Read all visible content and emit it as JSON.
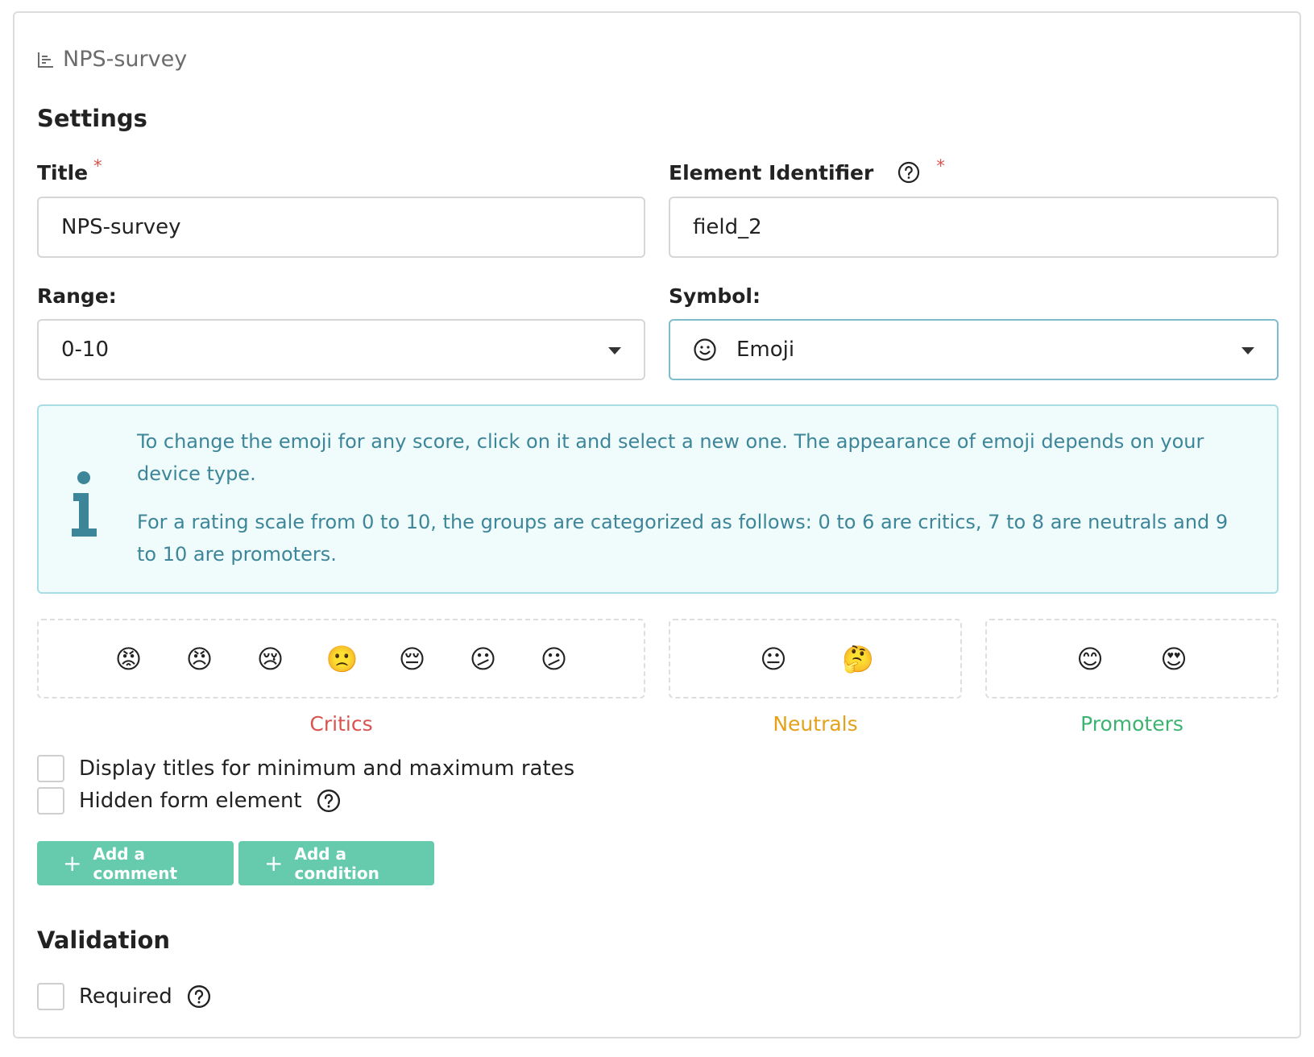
{
  "breadcrumb": {
    "icon": "bar-chart-icon",
    "label": "NPS-survey"
  },
  "settings": {
    "heading": "Settings",
    "title": {
      "label": "Title",
      "required_mark": "*",
      "value": "NPS-survey"
    },
    "identifier": {
      "label": "Element Identifier",
      "required_mark": "*",
      "value": "field_2"
    },
    "range": {
      "label": "Range:",
      "value": "0-10"
    },
    "symbol": {
      "label": "Symbol:",
      "value": "Emoji",
      "icon": "smiley-icon"
    }
  },
  "info": {
    "line1": "To change the emoji for any score, click on it and select a new one. The appearance of emoji depends on your device type.",
    "line2": "For a rating scale from 0 to 10, the groups are categorized as follows: 0 to 6 are critics, 7 to 8 are neutrals and 9 to 10 are promoters."
  },
  "groups": {
    "critics": {
      "label": "Critics",
      "color": "#d9534f",
      "emojis": [
        "😡",
        "😠",
        "😢",
        "🙁",
        "😔",
        "😕",
        "😕"
      ]
    },
    "neutrals": {
      "label": "Neutrals",
      "color": "#e3a21a",
      "emojis": [
        "😐",
        "🤔"
      ]
    },
    "promoters": {
      "label": "Promoters",
      "color": "#3cb371",
      "emojis": [
        "😊",
        "😍"
      ]
    }
  },
  "options": {
    "display_titles": "Display titles for minimum and maximum rates",
    "hidden_element": "Hidden form element"
  },
  "buttons": {
    "plus": "+",
    "add_comment": "Add a comment",
    "add_condition": "Add a condition",
    "color": "#65cbac"
  },
  "validation": {
    "heading": "Validation",
    "required": "Required"
  }
}
